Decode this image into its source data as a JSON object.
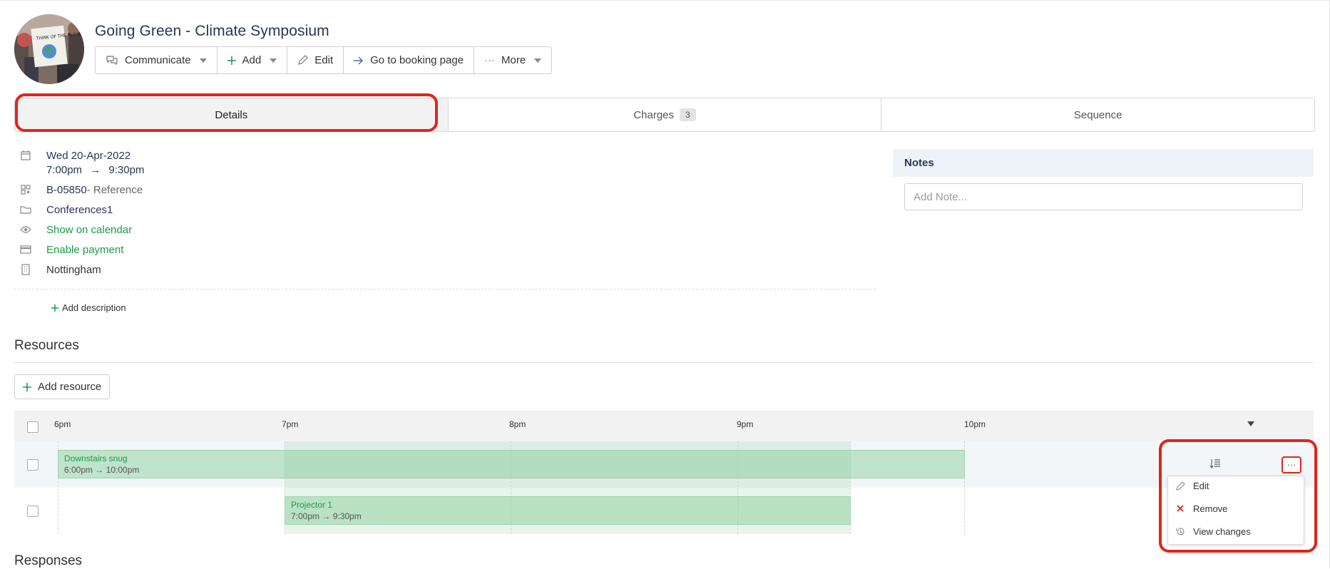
{
  "header": {
    "title": "Going Green - Climate Symposium",
    "avatar_caption": "THINK OF THE PLANET"
  },
  "toolbar": {
    "communicate": "Communicate",
    "add": "Add",
    "edit": "Edit",
    "booking": "Go to booking page",
    "more": "More"
  },
  "tabs": {
    "details": "Details",
    "charges": "Charges",
    "charges_count": "3",
    "sequence": "Sequence"
  },
  "details": {
    "date": "Wed 20-Apr-2022",
    "time_start": "7:00pm",
    "arrow": "→",
    "time_end": "9:30pm",
    "ref_code": "B-05850",
    "ref_suffix": " - Reference",
    "folder": "Conferences1",
    "show_calendar": "Show on calendar",
    "enable_payment": "Enable payment",
    "location": "Nottingham",
    "add_description": "Add description"
  },
  "notes": {
    "title": "Notes",
    "placeholder": "Add Note..."
  },
  "resources": {
    "title": "Resources",
    "add_label": "Add resource",
    "ticks": [
      "6pm",
      "7pm",
      "8pm",
      "9pm",
      "10pm"
    ],
    "rows": [
      {
        "name": "Downstairs snug",
        "time": "6:00pm → 10:00pm"
      },
      {
        "name": "Projector 1",
        "time": "7:00pm → 9:30pm"
      }
    ]
  },
  "menu": {
    "edit": "Edit",
    "remove": "Remove",
    "view_changes": "View changes"
  },
  "responses": {
    "title": "Responses"
  },
  "colors": {
    "accent_navy": "#2c3556",
    "green": "#1a9c4a",
    "highlight_red": "#e2241c",
    "bar_green": "#c5ebd0"
  }
}
